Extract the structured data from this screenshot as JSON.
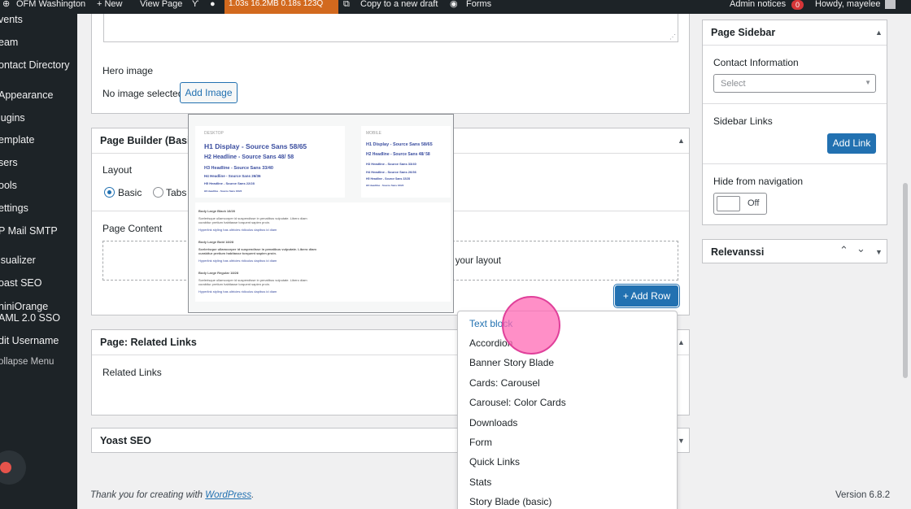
{
  "adminbar": {
    "site_name": "OFM Washington",
    "new_label": "+ New",
    "view_page": "View Page",
    "perf": "1.03s  16.2MB  0.18s  123Q",
    "copy_draft": "Copy to a new draft",
    "forms": "Forms",
    "admin_notices": "Admin notices",
    "notice_count": "0",
    "howdy": "Howdy, mayelee"
  },
  "sidebar": {
    "items": [
      "vents",
      "eam",
      "ontact Directory",
      "Appearance",
      "lugins",
      "emplate",
      "sers",
      "ools",
      "ettings",
      "P Mail SMTP",
      "isualizer",
      "oast SEO",
      "niniOrange",
      "AML 2.0 SSO",
      "dit Username",
      "ollapse Menu"
    ]
  },
  "hero": {
    "label": "Hero image",
    "status": "No image selected",
    "add_image": "Add Image"
  },
  "page_builder": {
    "title": "Page Builder (Basic",
    "layout_label": "Layout",
    "layout_basic": "Basic",
    "layout_tabs": "Tabs",
    "content_label": "Page Content",
    "drop_text": "ting your layout",
    "add_row": "+ Add Row"
  },
  "preview": {
    "desktop_label": "DESKTOP",
    "mobile_label": "MOBILE",
    "desktop_lines": [
      "H1 Display - Source Sans 58/65",
      "H2 Headline - Source Sans 48/ 58",
      "H3 Headline - Source Sans 33/40",
      "H4 Headline - Source Sans 26/36",
      "H5 Headline - Source Sans 22/28",
      "H6 Headline - Source Sans 16/24"
    ],
    "mobile_lines": [
      "H1 Display - Source Sans 58/65",
      "H2 Headline - Source Sans 48/ 58",
      "H3 Headline - Source Sans 33/40",
      "H4 Headline - Source Sans 26/36",
      "H5 Headline - Source Sans 22/28",
      "H6 Headline - Source Sans 16/24"
    ],
    "body_lines": [
      "Body Large Black 18/28",
      "Scelerisque ullamcorper id suspendisse in penatibus vulputate. Libero diam curabitur pretium habitasse torquent sapien proin.",
      "Hyperlink styling has ultricies ridiculus dapibus id diam",
      "Body Large Bold 18/28",
      "Scelerisque ullamcorper id suspendisse in penatibus vulputate. Libero diam curabitur pretium habitasse torquent sapien proin.",
      "Hyperlink styling has ultricies ridiculus dapibus id diam",
      "Body Large Regular 18/28",
      "Scelerisque ullamcorper id suspendisse in penatibus vulputate. Libero diam curabitur pretium habitasse torquent sapien proin.",
      "Hyperlink styling has ultricies ridiculus dapibus id diam"
    ]
  },
  "related_links": {
    "title": "Page: Related Links",
    "label": "Related Links"
  },
  "yoast": {
    "title": "Yoast SEO"
  },
  "dropdown": {
    "options": [
      "Text block",
      "Accordion",
      "Banner Story Blade",
      "Cards: Carousel",
      "Carousel: Color Cards",
      "Downloads",
      "Form",
      "Quick Links",
      "Stats",
      "Story Blade (basic)"
    ]
  },
  "page_sidebar": {
    "title": "Page Sidebar",
    "contact_label": "Contact Information",
    "select_placeholder": "Select",
    "sidebar_links_label": "Sidebar Links",
    "add_link": "Add Link",
    "hide_nav_label": "Hide from navigation",
    "toggle_state": "Off"
  },
  "relevanssi": {
    "title": "Relevanssi"
  },
  "footer": {
    "thanks_prefix": "Thank you for creating with ",
    "wordpress": "WordPress",
    "thanks_suffix": ".",
    "version": "Version 6.8.2"
  },
  "colors": {
    "accent": "#2271b1",
    "cursor": "#ff69b4"
  }
}
